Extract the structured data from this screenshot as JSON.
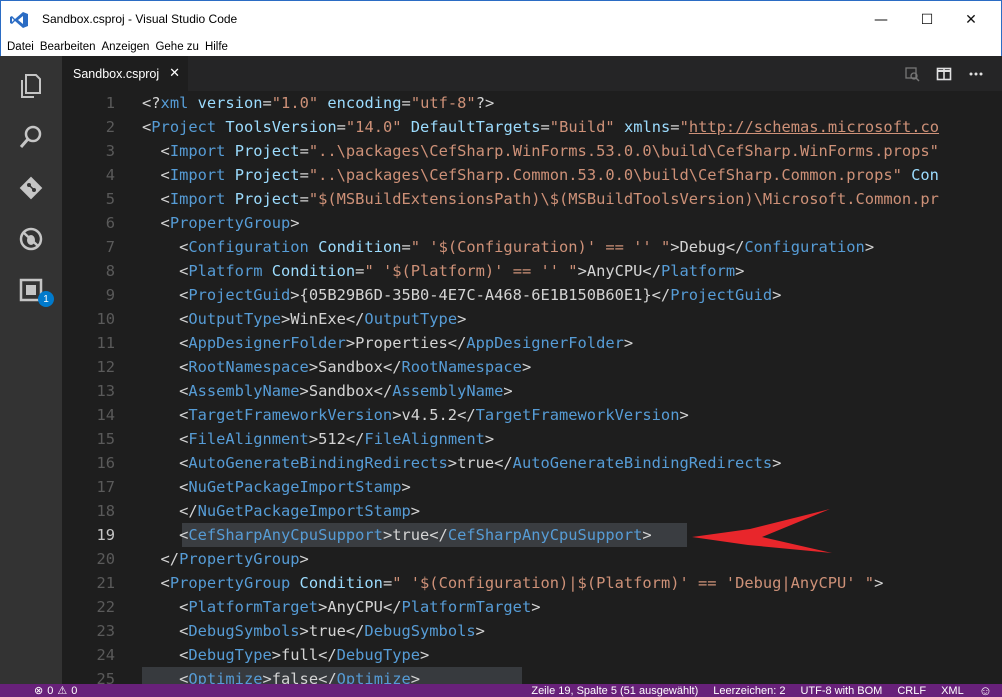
{
  "window": {
    "title": "Sandbox.csproj - Visual Studio Code",
    "controls": {
      "minimize": "—",
      "maximize": "☐",
      "close": "✕"
    }
  },
  "menu": [
    {
      "label": "Datei"
    },
    {
      "label": "Bearbeiten"
    },
    {
      "label": "Anzeigen"
    },
    {
      "label": "Gehe zu"
    },
    {
      "label": "Hilfe"
    }
  ],
  "activity_bar": {
    "icons": [
      "explorer-icon",
      "search-icon",
      "git-icon",
      "debug-icon",
      "extensions-icon"
    ],
    "extensions_badge": "1"
  },
  "tab": {
    "label": "Sandbox.csproj",
    "close": "✕"
  },
  "editor_actions": [
    "open-changes-icon",
    "split-editor-icon",
    "more-icon"
  ],
  "code_lines": [
    {
      "n": "1",
      "tokens": [
        [
          "t-txt",
          "<?"
        ],
        [
          "t-tag",
          "xml"
        ],
        [
          "t-attr",
          " version"
        ],
        [
          "t-txt",
          "="
        ],
        [
          "t-str",
          "\"1.0\""
        ],
        [
          "t-attr",
          " encoding"
        ],
        [
          "t-txt",
          "="
        ],
        [
          "t-str",
          "\"utf-8\""
        ],
        [
          "t-txt",
          "?>"
        ]
      ]
    },
    {
      "n": "2",
      "tokens": [
        [
          "t-txt",
          "<"
        ],
        [
          "t-tag",
          "Project"
        ],
        [
          "t-attr",
          " ToolsVersion"
        ],
        [
          "t-txt",
          "="
        ],
        [
          "t-str",
          "\"14.0\""
        ],
        [
          "t-attr",
          " DefaultTargets"
        ],
        [
          "t-txt",
          "="
        ],
        [
          "t-str",
          "\"Build\""
        ],
        [
          "t-attr",
          " xmlns"
        ],
        [
          "t-txt",
          "="
        ],
        [
          "t-str",
          "\""
        ],
        [
          "t-link",
          "http://schemas.microsoft.co"
        ]
      ]
    },
    {
      "n": "3",
      "tokens": [
        [
          "t-txt",
          "  <"
        ],
        [
          "t-tag",
          "Import"
        ],
        [
          "t-attr",
          " Project"
        ],
        [
          "t-txt",
          "="
        ],
        [
          "t-str",
          "\"..\\packages\\CefSharp.WinForms.53.0.0\\build\\CefSharp.WinForms.props\""
        ]
      ]
    },
    {
      "n": "4",
      "tokens": [
        [
          "t-txt",
          "  <"
        ],
        [
          "t-tag",
          "Import"
        ],
        [
          "t-attr",
          " Project"
        ],
        [
          "t-txt",
          "="
        ],
        [
          "t-str",
          "\"..\\packages\\CefSharp.Common.53.0.0\\build\\CefSharp.Common.props\""
        ],
        [
          "t-attr",
          " Con"
        ]
      ]
    },
    {
      "n": "5",
      "tokens": [
        [
          "t-txt",
          "  <"
        ],
        [
          "t-tag",
          "Import"
        ],
        [
          "t-attr",
          " Project"
        ],
        [
          "t-txt",
          "="
        ],
        [
          "t-str",
          "\"$(MSBuildExtensionsPath)\\$(MSBuildToolsVersion)\\Microsoft.Common.pr"
        ]
      ]
    },
    {
      "n": "6",
      "tokens": [
        [
          "t-txt",
          "  <"
        ],
        [
          "t-tag",
          "PropertyGroup"
        ],
        [
          "t-txt",
          ">"
        ]
      ]
    },
    {
      "n": "7",
      "tokens": [
        [
          "t-txt",
          "    <"
        ],
        [
          "t-tag",
          "Configuration"
        ],
        [
          "t-attr",
          " Condition"
        ],
        [
          "t-txt",
          "="
        ],
        [
          "t-str",
          "\" '$(Configuration)' == '' \""
        ],
        [
          "t-txt",
          ">Debug</"
        ],
        [
          "t-tag",
          "Configuration"
        ],
        [
          "t-txt",
          ">"
        ]
      ]
    },
    {
      "n": "8",
      "tokens": [
        [
          "t-txt",
          "    <"
        ],
        [
          "t-tag",
          "Platform"
        ],
        [
          "t-attr",
          " Condition"
        ],
        [
          "t-txt",
          "="
        ],
        [
          "t-str",
          "\" '$(Platform)' == '' \""
        ],
        [
          "t-txt",
          ">AnyCPU</"
        ],
        [
          "t-tag",
          "Platform"
        ],
        [
          "t-txt",
          ">"
        ]
      ]
    },
    {
      "n": "9",
      "tokens": [
        [
          "t-txt",
          "    <"
        ],
        [
          "t-tag",
          "ProjectGuid"
        ],
        [
          "t-txt",
          ">{05B29B6D-35B0-4E7C-A468-6E1B150B60E1}</"
        ],
        [
          "t-tag",
          "ProjectGuid"
        ],
        [
          "t-txt",
          ">"
        ]
      ]
    },
    {
      "n": "10",
      "tokens": [
        [
          "t-txt",
          "    <"
        ],
        [
          "t-tag",
          "OutputType"
        ],
        [
          "t-txt",
          ">WinExe</"
        ],
        [
          "t-tag",
          "OutputType"
        ],
        [
          "t-txt",
          ">"
        ]
      ]
    },
    {
      "n": "11",
      "tokens": [
        [
          "t-txt",
          "    <"
        ],
        [
          "t-tag",
          "AppDesignerFolder"
        ],
        [
          "t-txt",
          ">Properties</"
        ],
        [
          "t-tag",
          "AppDesignerFolder"
        ],
        [
          "t-txt",
          ">"
        ]
      ]
    },
    {
      "n": "12",
      "tokens": [
        [
          "t-txt",
          "    <"
        ],
        [
          "t-tag",
          "RootNamespace"
        ],
        [
          "t-txt",
          ">Sandbox</"
        ],
        [
          "t-tag",
          "RootNamespace"
        ],
        [
          "t-txt",
          ">"
        ]
      ]
    },
    {
      "n": "13",
      "tokens": [
        [
          "t-txt",
          "    <"
        ],
        [
          "t-tag",
          "AssemblyName"
        ],
        [
          "t-txt",
          ">Sandbox</"
        ],
        [
          "t-tag",
          "AssemblyName"
        ],
        [
          "t-txt",
          ">"
        ]
      ]
    },
    {
      "n": "14",
      "tokens": [
        [
          "t-txt",
          "    <"
        ],
        [
          "t-tag",
          "TargetFrameworkVersion"
        ],
        [
          "t-txt",
          ">v4.5.2</"
        ],
        [
          "t-tag",
          "TargetFrameworkVersion"
        ],
        [
          "t-txt",
          ">"
        ]
      ]
    },
    {
      "n": "15",
      "tokens": [
        [
          "t-txt",
          "    <"
        ],
        [
          "t-tag",
          "FileAlignment"
        ],
        [
          "t-txt",
          ">512</"
        ],
        [
          "t-tag",
          "FileAlignment"
        ],
        [
          "t-txt",
          ">"
        ]
      ]
    },
    {
      "n": "16",
      "tokens": [
        [
          "t-txt",
          "    <"
        ],
        [
          "t-tag",
          "AutoGenerateBindingRedirects"
        ],
        [
          "t-txt",
          ">true</"
        ],
        [
          "t-tag",
          "AutoGenerateBindingRedirects"
        ],
        [
          "t-txt",
          ">"
        ]
      ]
    },
    {
      "n": "17",
      "tokens": [
        [
          "t-txt",
          "    <"
        ],
        [
          "t-tag",
          "NuGetPackageImportStamp"
        ],
        [
          "t-txt",
          ">"
        ]
      ]
    },
    {
      "n": "18",
      "tokens": [
        [
          "t-txt",
          "    </"
        ],
        [
          "t-tag",
          "NuGetPackageImportStamp"
        ],
        [
          "t-txt",
          ">"
        ]
      ]
    },
    {
      "n": "19",
      "tokens": [
        [
          "t-txt",
          "    <"
        ],
        [
          "t-tag",
          "CefSharpAnyCpuSupport"
        ],
        [
          "t-txt",
          ">true</"
        ],
        [
          "t-tag",
          "CefSharpAnyCpuSupport"
        ],
        [
          "t-txt",
          ">"
        ]
      ]
    },
    {
      "n": "20",
      "tokens": [
        [
          "t-txt",
          "  </"
        ],
        [
          "t-tag",
          "PropertyGroup"
        ],
        [
          "t-txt",
          ">"
        ]
      ]
    },
    {
      "n": "21",
      "tokens": [
        [
          "t-txt",
          "  <"
        ],
        [
          "t-tag",
          "PropertyGroup"
        ],
        [
          "t-attr",
          " Condition"
        ],
        [
          "t-txt",
          "="
        ],
        [
          "t-str",
          "\" '$(Configuration)|$(Platform)' == 'Debug|AnyCPU' \""
        ],
        [
          "t-txt",
          ">"
        ]
      ]
    },
    {
      "n": "22",
      "tokens": [
        [
          "t-txt",
          "    <"
        ],
        [
          "t-tag",
          "PlatformTarget"
        ],
        [
          "t-txt",
          ">AnyCPU</"
        ],
        [
          "t-tag",
          "PlatformTarget"
        ],
        [
          "t-txt",
          ">"
        ]
      ]
    },
    {
      "n": "23",
      "tokens": [
        [
          "t-txt",
          "    <"
        ],
        [
          "t-tag",
          "DebugSymbols"
        ],
        [
          "t-txt",
          ">true</"
        ],
        [
          "t-tag",
          "DebugSymbols"
        ],
        [
          "t-txt",
          ">"
        ]
      ]
    },
    {
      "n": "24",
      "tokens": [
        [
          "t-txt",
          "    <"
        ],
        [
          "t-tag",
          "DebugType"
        ],
        [
          "t-txt",
          ">full</"
        ],
        [
          "t-tag",
          "DebugType"
        ],
        [
          "t-txt",
          ">"
        ]
      ]
    },
    {
      "n": "25",
      "tokens": [
        [
          "t-txt",
          "    <"
        ],
        [
          "t-tag",
          "Optimize"
        ],
        [
          "t-txt",
          ">false</"
        ],
        [
          "t-tag",
          "Optimize"
        ],
        [
          "t-txt",
          ">"
        ]
      ]
    }
  ],
  "status_bar": {
    "errors": "0",
    "warnings": "0",
    "position": "Zeile 19, Spalte 5 (51 ausgewählt)",
    "indent": "Leerzeichen: 2",
    "encoding": "UTF-8 with BOM",
    "eol": "CRLF",
    "language": "XML",
    "feedback": "☺"
  },
  "colors": {
    "status_bar": "#68217a",
    "activity_bar": "#333333",
    "editor_bg": "#1e1e1e",
    "annotation_arrow": "#e8262b"
  }
}
